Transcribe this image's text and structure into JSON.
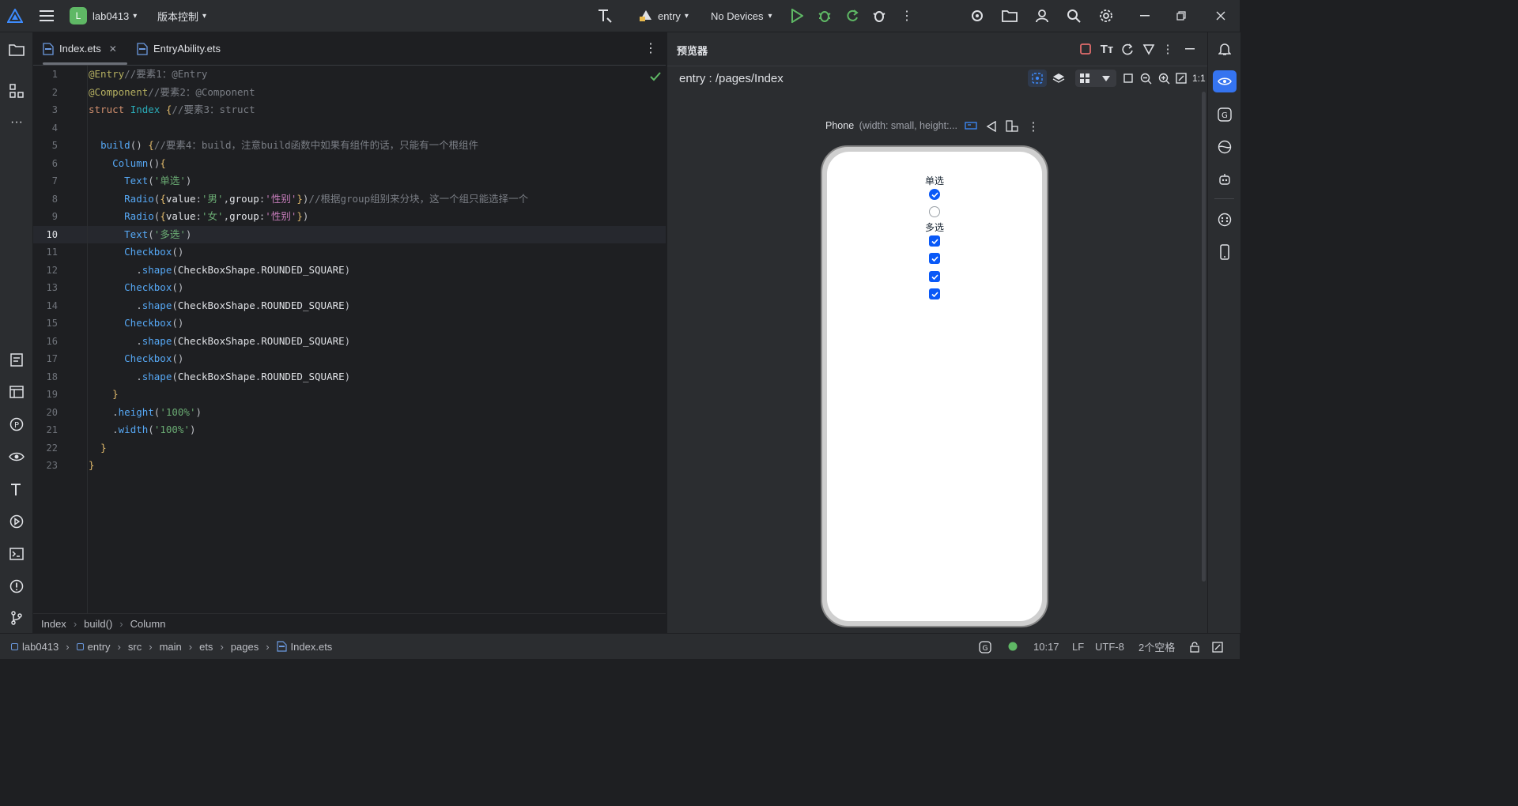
{
  "topbar": {
    "project_initial": "L",
    "project_name": "lab0413",
    "vcs_label": "版本控制",
    "module": "entry",
    "devices": "No Devices"
  },
  "editor": {
    "tabs": [
      {
        "label": "Index.ets",
        "active": true
      },
      {
        "label": "EntryAbility.ets",
        "active": false
      }
    ],
    "current_line": 10,
    "breadcrumb": [
      "Index",
      "build()",
      "Column"
    ]
  },
  "preview": {
    "title": "预览器",
    "path": "entry : /pages/Index",
    "zoom_label": "1:1",
    "device_name": "Phone",
    "device_detail": "(width: small, height:...",
    "screen": {
      "text_single": "单选",
      "radios": [
        {
          "checked": true
        },
        {
          "checked": false
        }
      ],
      "text_multi": "多选",
      "checkboxes": [
        {
          "checked": true
        },
        {
          "checked": true
        },
        {
          "checked": true
        },
        {
          "checked": true
        }
      ]
    }
  },
  "statusbar": {
    "path": [
      "lab0413",
      "entry",
      "src",
      "main",
      "ets",
      "pages",
      "Index.ets"
    ],
    "position": "10:17",
    "line_sep": "LF",
    "encoding": "UTF-8",
    "indent": "2个空格"
  },
  "colors": {
    "accent": "#3574f0",
    "checkbox": "#0a59f7",
    "run_green": "#5fb865",
    "project_badge": "#5fb865"
  }
}
